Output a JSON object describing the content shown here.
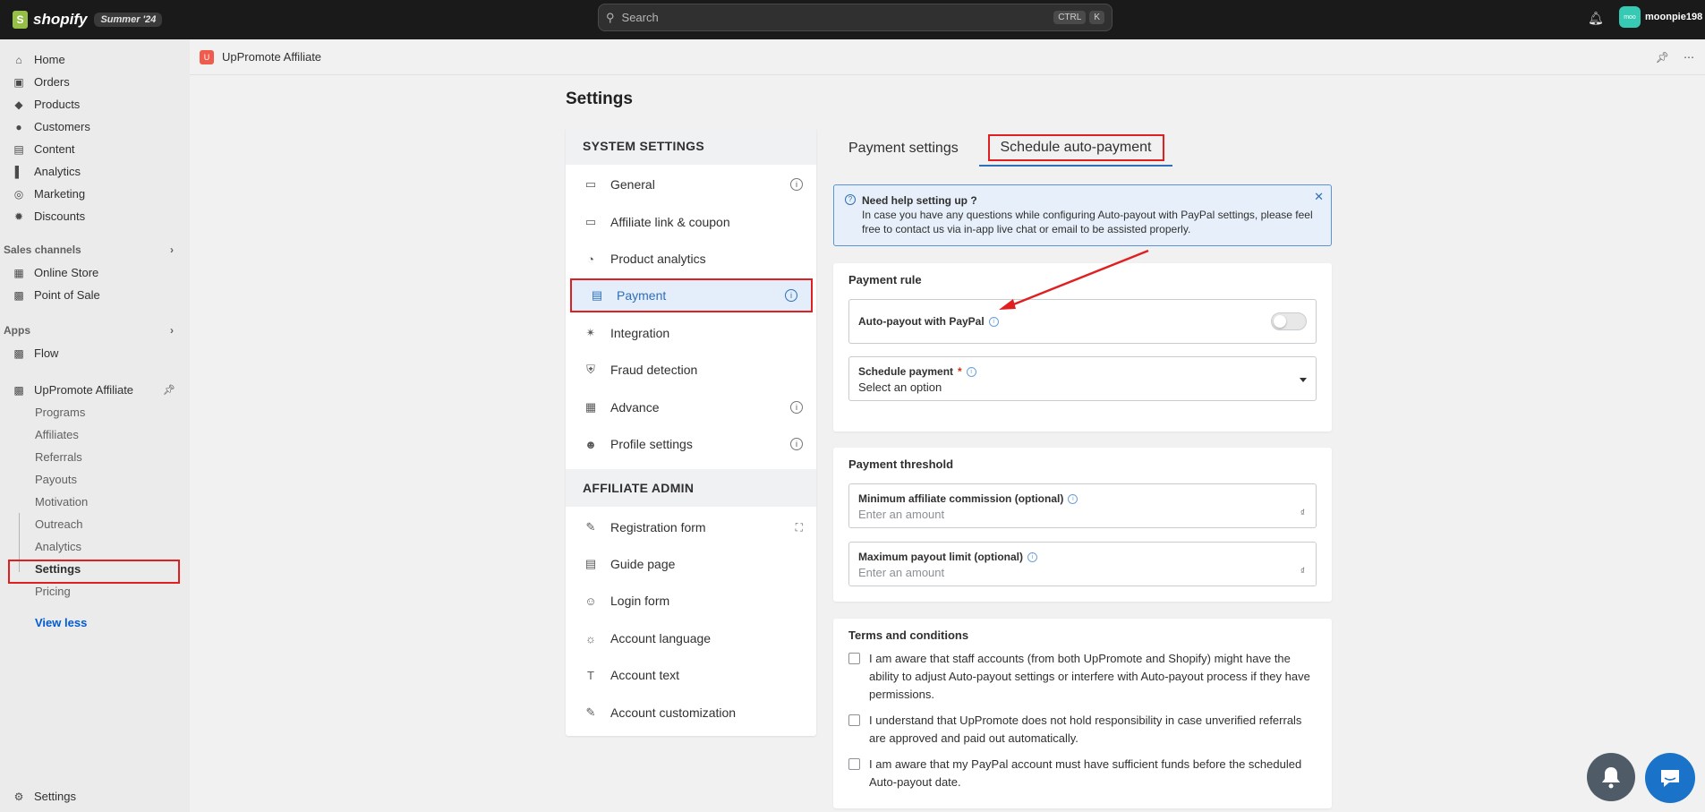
{
  "topbar": {
    "brand": "shopify",
    "edition": "Summer '24",
    "search_placeholder": "Search",
    "shortcut_keys": [
      "CTRL",
      "K"
    ],
    "user_avatar": "moo",
    "user_name": "moonpie198"
  },
  "sidebar": {
    "main_items": [
      {
        "label": "Home",
        "icon": "home-icon"
      },
      {
        "label": "Orders",
        "icon": "orders-icon"
      },
      {
        "label": "Products",
        "icon": "tag-icon"
      },
      {
        "label": "Customers",
        "icon": "person-icon"
      },
      {
        "label": "Content",
        "icon": "image-icon"
      },
      {
        "label": "Analytics",
        "icon": "bar-chart-icon"
      },
      {
        "label": "Marketing",
        "icon": "target-icon"
      },
      {
        "label": "Discounts",
        "icon": "discount-icon"
      }
    ],
    "sales_channels_label": "Sales channels",
    "sales_channels": [
      {
        "label": "Online Store",
        "icon": "store-icon"
      },
      {
        "label": "Point of Sale",
        "icon": "pos-icon"
      }
    ],
    "apps_label": "Apps",
    "apps": [
      {
        "label": "Flow",
        "icon": "flow-icon"
      }
    ],
    "app_name": "UpPromote Affiliate",
    "app_subitems": [
      "Programs",
      "Affiliates",
      "Referrals",
      "Payouts",
      "Motivation",
      "Outreach",
      "Analytics",
      "Settings",
      "Pricing"
    ],
    "view_less": "View less",
    "bottom_settings": "Settings"
  },
  "appbar": {
    "title": "UpPromote Affiliate"
  },
  "page": {
    "title": "Settings"
  },
  "settings_nav": {
    "system_header": "SYSTEM SETTINGS",
    "system_items": [
      {
        "label": "General",
        "icon": "inbox-icon",
        "info": true
      },
      {
        "label": "Affiliate link & coupon",
        "icon": "ticket-icon",
        "info": false
      },
      {
        "label": "Product analytics",
        "icon": "pie-chart-icon",
        "info": false
      },
      {
        "label": "Payment",
        "icon": "credit-card-icon",
        "info": true,
        "active": true
      },
      {
        "label": "Integration",
        "icon": "network-icon",
        "info": false
      },
      {
        "label": "Fraud detection",
        "icon": "shield-icon",
        "info": false
      },
      {
        "label": "Advance",
        "icon": "calculator-icon",
        "info": true
      },
      {
        "label": "Profile settings",
        "icon": "user-icon",
        "info": true
      }
    ],
    "admin_header": "AFFILIATE ADMIN",
    "admin_items": [
      {
        "label": "Registration form",
        "icon": "signature-icon"
      },
      {
        "label": "Guide page",
        "icon": "document-icon"
      },
      {
        "label": "Login form",
        "icon": "users-icon"
      },
      {
        "label": "Account language",
        "icon": "globe-icon"
      },
      {
        "label": "Account text",
        "icon": "text-icon"
      },
      {
        "label": "Account customization",
        "icon": "user-edit-icon"
      }
    ]
  },
  "tabs": [
    "Payment settings",
    "Schedule auto-payment"
  ],
  "help_banner": {
    "title": "Need help setting up ?",
    "body": "In case you have any questions while configuring Auto-payout with PayPal settings, please feel free to contact us via in-app live chat or email to be assisted properly."
  },
  "payment_rule": {
    "title": "Payment rule",
    "auto_payout_label": "Auto-payout with PayPal",
    "auto_payout_enabled": false,
    "schedule_label": "Schedule payment",
    "schedule_required_mark": "*",
    "schedule_value": "Select an option"
  },
  "payment_threshold": {
    "title": "Payment threshold",
    "min_label": "Minimum affiliate commission (optional)",
    "min_placeholder": "Enter an amount",
    "max_label": "Maximum payout limit (optional)",
    "max_placeholder": "Enter an amount",
    "currency": "₫"
  },
  "terms": {
    "title": "Terms and conditions",
    "items": [
      "I am aware that staff accounts (from both UpPromote and Shopify) might have the ability to adjust Auto-payout settings or interfere with Auto-payout process if they have permissions.",
      "I understand that UpPromote does not hold responsibility in case unverified referrals are approved and paid out automatically.",
      "I am aware that my PayPal account must have sufficient funds before the scheduled Auto-payout date."
    ]
  },
  "colors": {
    "highlight": "#e02020",
    "accent": "#2e6fb8",
    "topbar": "#1a1a1a"
  }
}
